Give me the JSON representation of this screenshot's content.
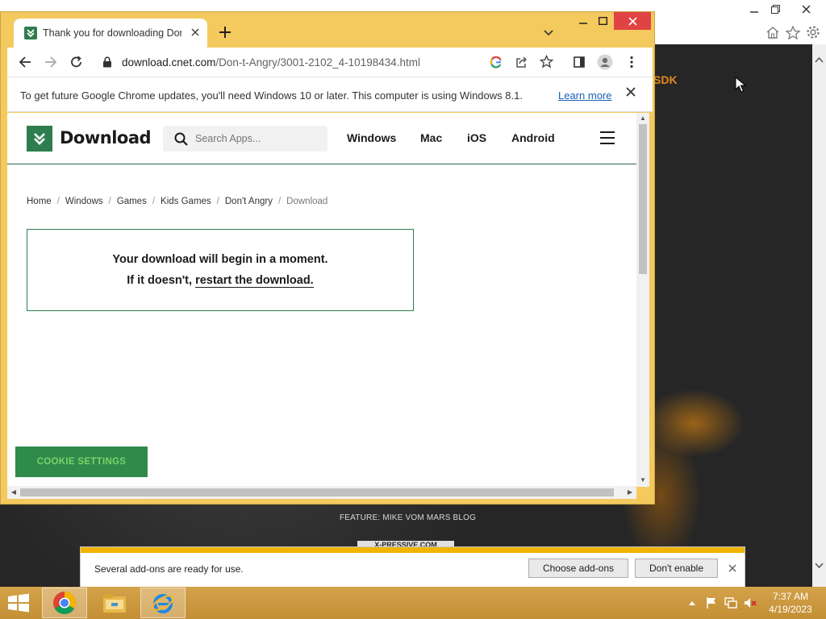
{
  "ie": {
    "orange_text": "SDK",
    "feature_text": "FEATURE: MIKE VOM MARS BLOG",
    "logo_text": "X-PRESSIVE.COM"
  },
  "chrome": {
    "tab_title": "Thank you for downloading Don",
    "tab_favicon": "download-cnet-favicon",
    "url_host": "download.cnet.com",
    "url_path": "/Don-t-Angry/3001-2102_4-10198434.html",
    "infobar": {
      "message": "To get future Google Chrome updates, you'll need Windows 10 or later. This computer is using Windows 8.1.",
      "link": "Learn more"
    }
  },
  "page": {
    "logo_text": "Download",
    "search_placeholder": "Search Apps...",
    "nav": [
      "Windows",
      "Mac",
      "iOS",
      "Android"
    ],
    "breadcrumb": [
      "Home",
      "Windows",
      "Games",
      "Kids Games",
      "Don't Angry",
      "Download"
    ],
    "download_line1": "Your download will begin in a moment.",
    "download_line2_prefix": "If it doesn't, ",
    "download_link": "restart the download.",
    "cookie_button": "COOKIE SETTINGS"
  },
  "notification": {
    "message": "Several add-ons are ready for use.",
    "choose_button": "Choose add-ons",
    "dont_enable_button": "Don't enable"
  },
  "taskbar": {
    "time": "7:37 AM",
    "date": "4/19/2023"
  },
  "colors": {
    "chrome_frame": "#f4c95d",
    "cnet_green": "#2e7d4f",
    "notif_accent": "#f0b400"
  }
}
